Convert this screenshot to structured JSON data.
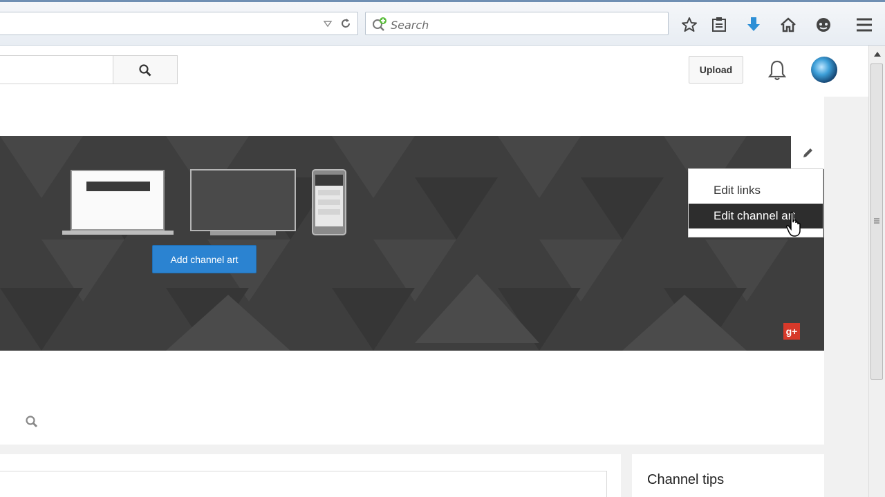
{
  "browser": {
    "search_placeholder": "Search"
  },
  "header": {
    "upload_label": "Upload"
  },
  "banner": {
    "add_channel_art_label": "Add channel art",
    "gplus_label": "g+",
    "menu": {
      "items": [
        {
          "label": "Edit links",
          "active": false
        },
        {
          "label": "Edit channel art",
          "active": true
        }
      ]
    }
  },
  "sidebar": {
    "channel_tips_title": "Channel tips"
  },
  "colors": {
    "accent": "#2b83d1",
    "banner_bg": "#3e3e3e",
    "menu_active_bg": "#2d2d2d",
    "gplus_red": "#d7392a"
  },
  "icons": [
    "dropdown-arrow-icon",
    "reload-icon",
    "search-icon",
    "star-icon",
    "reading-list-icon",
    "download-icon",
    "home-icon",
    "chat-icon",
    "hamburger-menu-icon",
    "bell-icon",
    "pencil-icon",
    "hand-cursor-icon"
  ]
}
